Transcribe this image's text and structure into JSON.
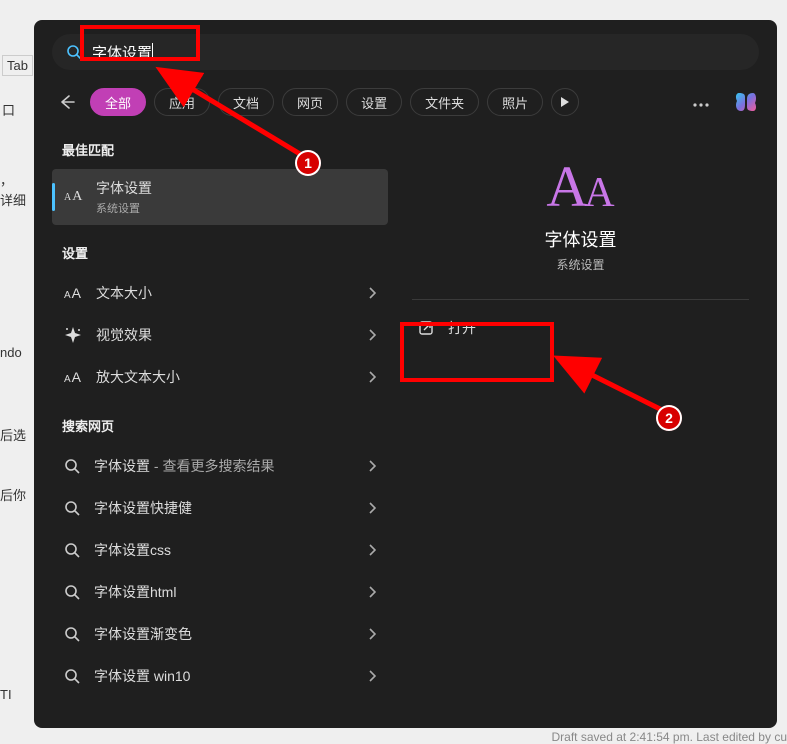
{
  "bg": {
    "tab": "Tab",
    "frag1": "详细",
    "frag2": "ndo",
    "frag3": "后选",
    "frag4": "后你",
    "frag5": "口",
    "frag6": "，",
    "frag7": "TI"
  },
  "search": {
    "query": "字体设置"
  },
  "tabs": {
    "items": [
      "全部",
      "应用",
      "文档",
      "网页",
      "设置",
      "文件夹",
      "照片"
    ]
  },
  "sections": {
    "best": "最佳匹配",
    "settings": "设置",
    "web": "搜索网页"
  },
  "best": {
    "title": "字体设置",
    "subtitle": "系统设置"
  },
  "settingsItems": [
    {
      "label": "文本大小",
      "icon": "text-size"
    },
    {
      "label": "视觉效果",
      "icon": "visual"
    },
    {
      "label": "放大文本大小",
      "icon": "text-size"
    }
  ],
  "webItems": [
    {
      "label": "字体设置",
      "suffix": " - 查看更多搜索结果"
    },
    {
      "label": "字体设置快捷健"
    },
    {
      "label": "字体设置css"
    },
    {
      "label": "字体设置html"
    },
    {
      "label": "字体设置渐变色"
    },
    {
      "label": "字体设置 win10"
    }
  ],
  "preview": {
    "title": "字体设置",
    "subtitle": "系统设置",
    "open": "打开"
  },
  "annotations": {
    "badge1": "1",
    "badge2": "2"
  },
  "footer": "Draft saved at 2:41:54 pm. Last edited by cu"
}
